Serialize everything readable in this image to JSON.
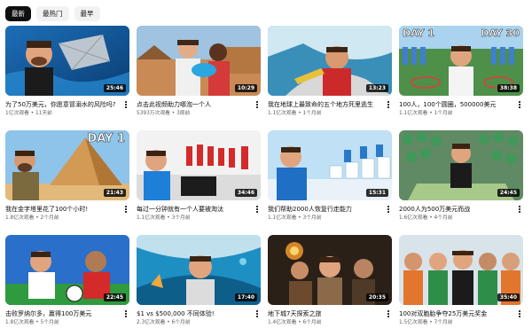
{
  "filters": [
    {
      "label": "最新",
      "active": true
    },
    {
      "label": "最热门",
      "active": false
    },
    {
      "label": "最早",
      "active": false
    }
  ],
  "videos": [
    {
      "title": "为了50万美元，你愿意冒溺水的风险吗?",
      "views": "1亿次观看",
      "age": "11天前",
      "duration": "25:46"
    },
    {
      "title": "点击此视频助力哪泡一个人",
      "views": "5393万次观看",
      "age": "3周前",
      "duration": "10:29"
    },
    {
      "title": "我在地球上最致命的五个地方死里逃生",
      "views": "1.1亿次观看",
      "age": "1个月前",
      "duration": "13:23"
    },
    {
      "title": "100人，100个圆圈，500000美元",
      "views": "1.1亿次观看",
      "age": "1个月前",
      "duration": "38:38",
      "overlay_left": "DAY 1",
      "overlay_right": "DAY 30"
    },
    {
      "title": "我在金字塔里花了100个小时!",
      "views": "1.8亿次观看",
      "age": "2个月前",
      "duration": "21:43",
      "overlay_right": "DAY 1"
    },
    {
      "title": "每过一分钟就有一个人要被淘汰",
      "views": "1.1亿次观看",
      "age": "3个月前",
      "duration": "34:46"
    },
    {
      "title": "我们帮助2000人恢复行走能力",
      "views": "1.1亿次观看",
      "age": "3个月前",
      "duration": "15:31"
    },
    {
      "title": "2000人为500万美元而战",
      "views": "1.6亿次观看",
      "age": "4个月前",
      "duration": "24:45"
    },
    {
      "title": "击败罗纳尔多，赢得100万美元",
      "views": "1.8亿次观看",
      "age": "5个月前",
      "duration": "22:45"
    },
    {
      "title": "$1 vs $500,000 不同体验!",
      "views": "2.3亿次观看",
      "age": "6个月前",
      "duration": "17:40"
    },
    {
      "title": "地下城7天探索之旅",
      "views": "1.4亿次观看",
      "age": "6个月前",
      "duration": "20:35"
    },
    {
      "title": "100对双胞胎争夺25万美元奖金",
      "views": "1.5亿次观看",
      "age": "7个月前",
      "duration": "35:40"
    }
  ],
  "meta_separator": " • ",
  "colors": {
    "chip_active": "#0f0f0f",
    "chip_inactive": "#f2f2f2",
    "meta_text": "#606060"
  }
}
